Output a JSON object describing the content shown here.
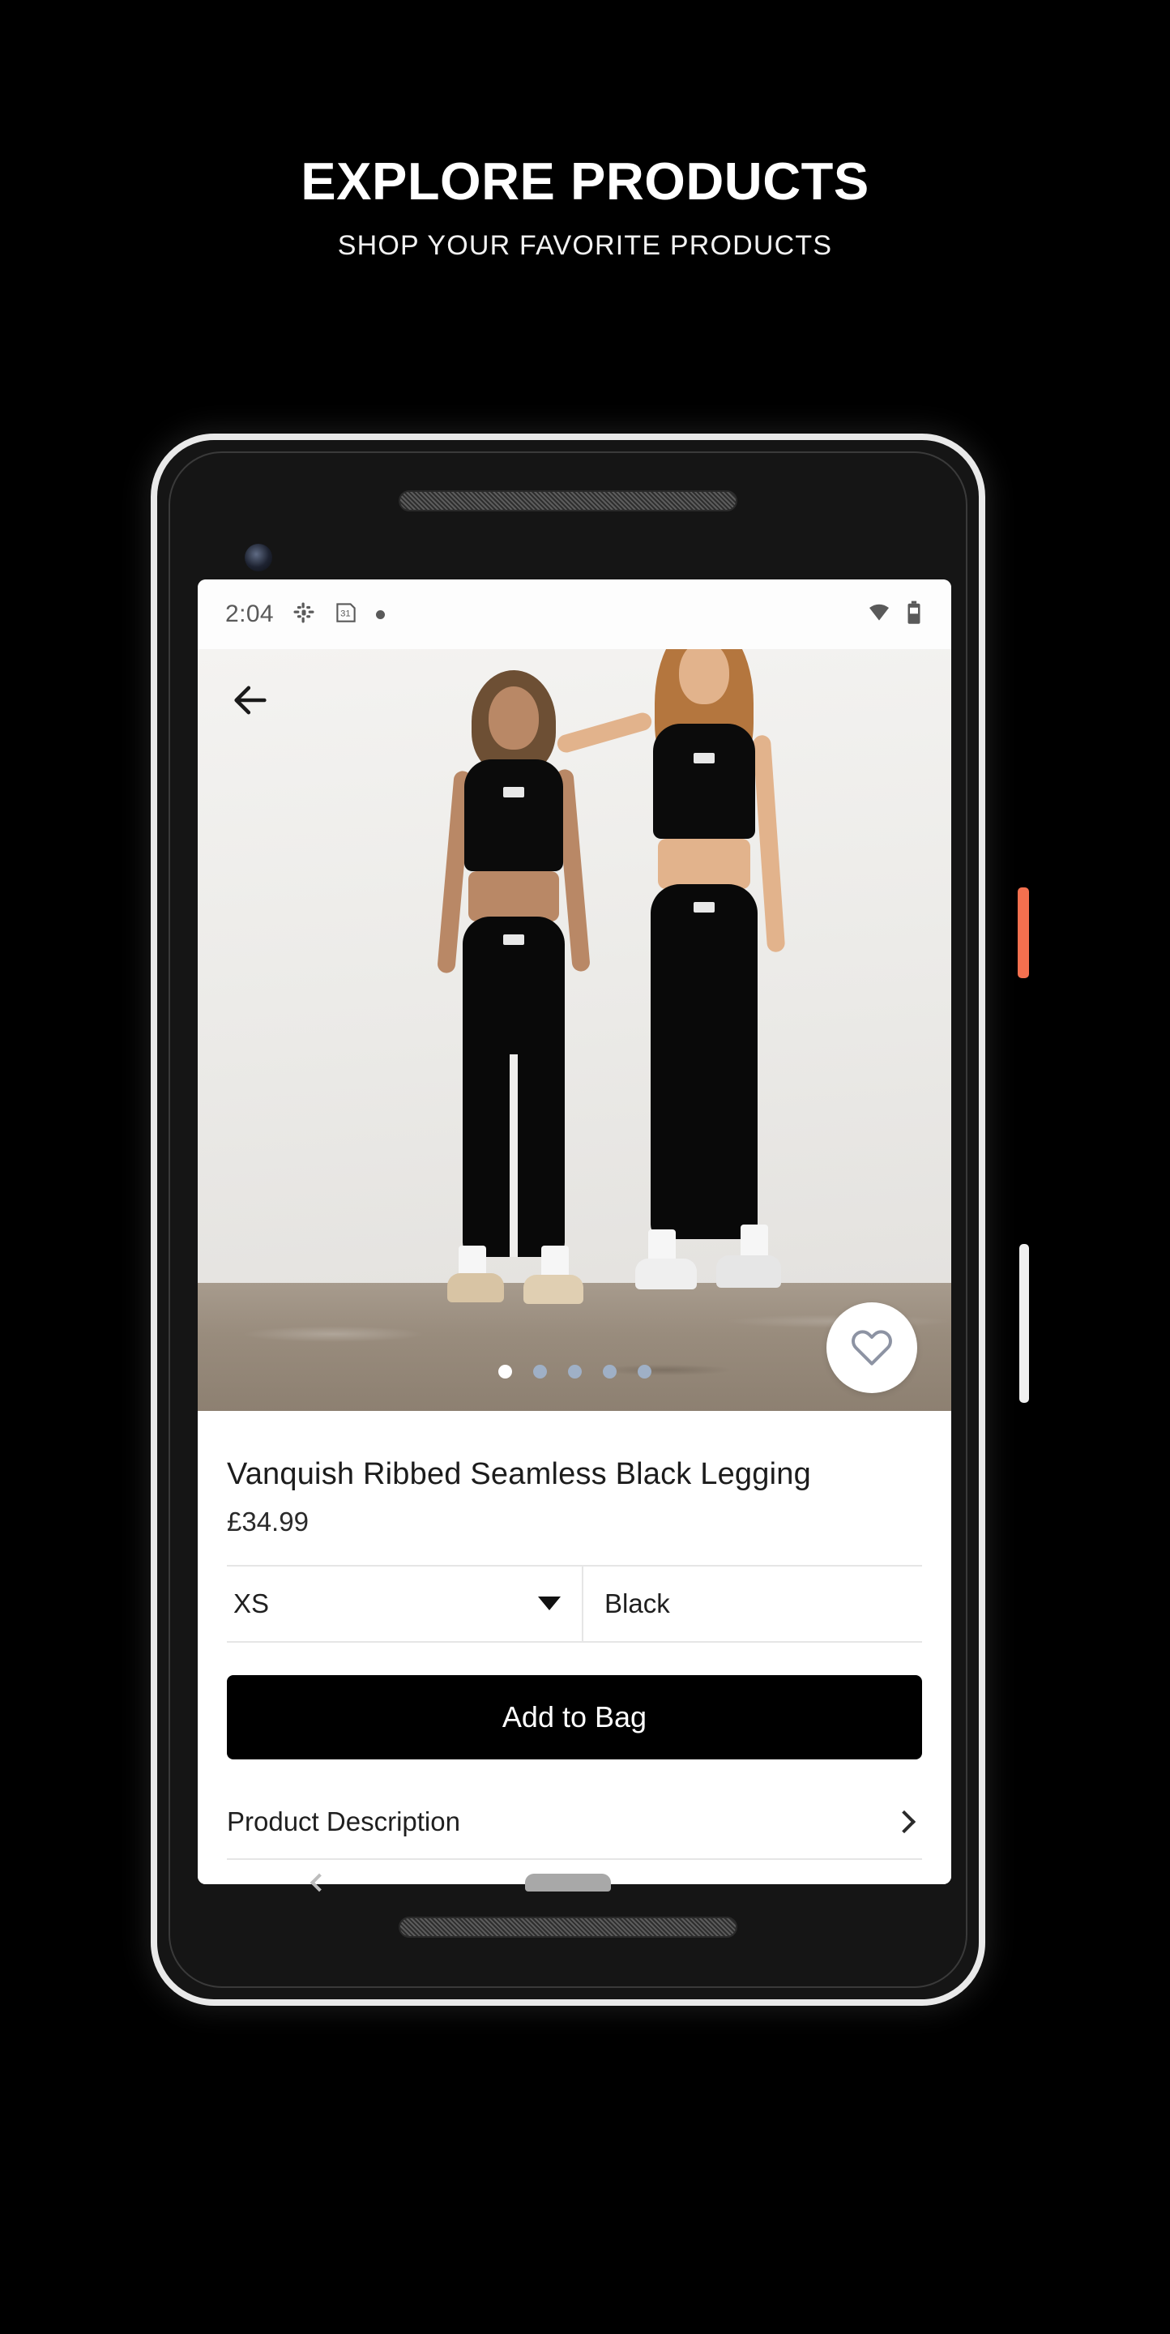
{
  "promo": {
    "title": "EXPLORE PRODUCTS",
    "subtitle": "SHOP YOUR FAVORITE PRODUCTS"
  },
  "status_bar": {
    "time": "2:04",
    "icons_left": [
      "slack-icon",
      "calendar-icon",
      "notification-dot"
    ],
    "calendar_day": "31",
    "icons_right": [
      "wifi-icon",
      "battery-icon"
    ]
  },
  "gallery": {
    "back_icon": "back-arrow-icon",
    "favorite_icon": "heart-icon",
    "dots_total": 5,
    "dots_active_index": 0
  },
  "product": {
    "title": "Vanquish Ribbed Seamless Black Legging",
    "price": "£34.99",
    "size_label": "XS",
    "color_label": "Black",
    "add_to_bag_label": "Add to Bag",
    "description_label": "Product Description",
    "description_chevron": "chevron-right-icon"
  },
  "device": {
    "power_button_color": "#f4704f",
    "volume_button_color": "#f0f0f0",
    "frame_color": "#e9e9e9"
  },
  "nav": {
    "back_icon": "nav-back-icon",
    "home_indicator": "home-pill"
  }
}
